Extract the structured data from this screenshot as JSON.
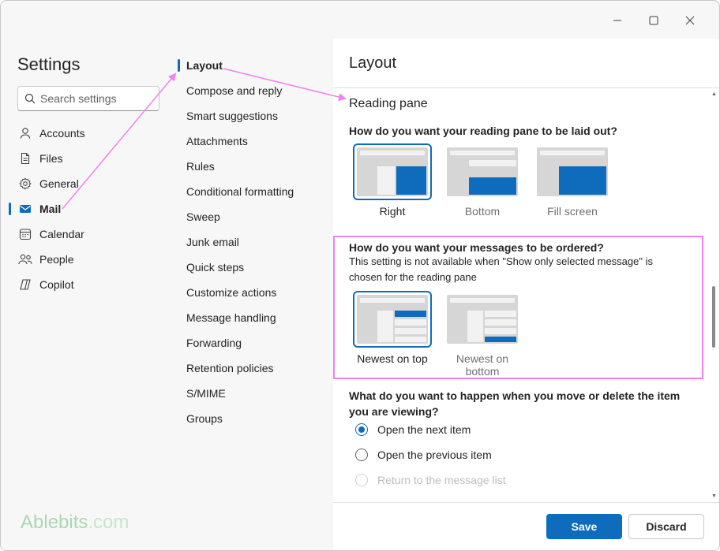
{
  "settings": {
    "title": "Settings",
    "search_placeholder": "Search settings",
    "nav": [
      {
        "label": "Accounts",
        "icon": "person-icon"
      },
      {
        "label": "Files",
        "icon": "file-icon"
      },
      {
        "label": "General",
        "icon": "gear-icon"
      },
      {
        "label": "Mail",
        "icon": "mail-icon",
        "active": true
      },
      {
        "label": "Calendar",
        "icon": "calendar-icon"
      },
      {
        "label": "People",
        "icon": "people-icon"
      },
      {
        "label": "Copilot",
        "icon": "copilot-icon"
      }
    ]
  },
  "mail_sections": [
    "Layout",
    "Compose and reply",
    "Smart suggestions",
    "Attachments",
    "Rules",
    "Conditional formatting",
    "Sweep",
    "Junk email",
    "Quick steps",
    "Customize actions",
    "Message handling",
    "Forwarding",
    "Retention policies",
    "S/MIME",
    "Groups"
  ],
  "layout": {
    "title": "Layout",
    "reading_pane": {
      "heading": "Reading pane",
      "question": "How do you want your reading pane to be laid out?",
      "options": [
        "Right",
        "Bottom",
        "Fill screen"
      ],
      "selected": "Right"
    },
    "ordering": {
      "question": "How do you want your messages to be ordered?",
      "note": "This setting is not available when \"Show only selected message\" is chosen for the reading pane",
      "options": [
        "Newest on top",
        "Newest on bottom"
      ],
      "selected": "Newest on top"
    },
    "move_delete": {
      "question": "What do you want to happen when you move or delete the item you are viewing?",
      "options": [
        "Open the next item",
        "Open the previous item",
        "Return to the message list"
      ],
      "selected": "Open the next item",
      "disabled": "Return to the message list"
    }
  },
  "footer": {
    "save_label": "Save",
    "discard_label": "Discard"
  },
  "brand": {
    "name": "Ablebits",
    "suffix": ".com"
  },
  "colors": {
    "accent": "#0f6cbd",
    "annotation": "#ee82ee",
    "brand": "#a9d8b0"
  }
}
